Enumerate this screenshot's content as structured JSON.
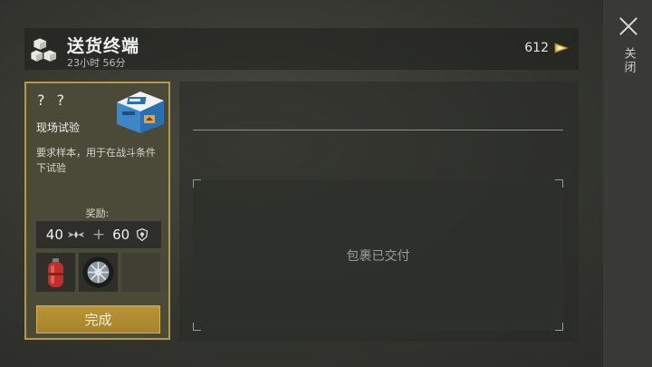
{
  "header": {
    "title": "送货终端",
    "timer": "23小时 56分",
    "currency_value": "612",
    "icon": "boxes-icon",
    "currency_icon": "coin-icon"
  },
  "close": {
    "label": "关闭",
    "icon": "close-icon"
  },
  "task": {
    "unknown": "? ?",
    "title": "现场试验",
    "description": "要求样本，用于在战斗条件下试验",
    "reward_label": "奖励:",
    "reward_xp": "40",
    "reward_plus": "+",
    "reward_rep": "60",
    "items": [
      "gas-canister-icon",
      "wheel-icon"
    ],
    "complete_label": "完成"
  },
  "delivery": {
    "status": "包裹已交付"
  },
  "colors": {
    "accent_gold": "#b59a46",
    "button_gold": "#b99436"
  }
}
